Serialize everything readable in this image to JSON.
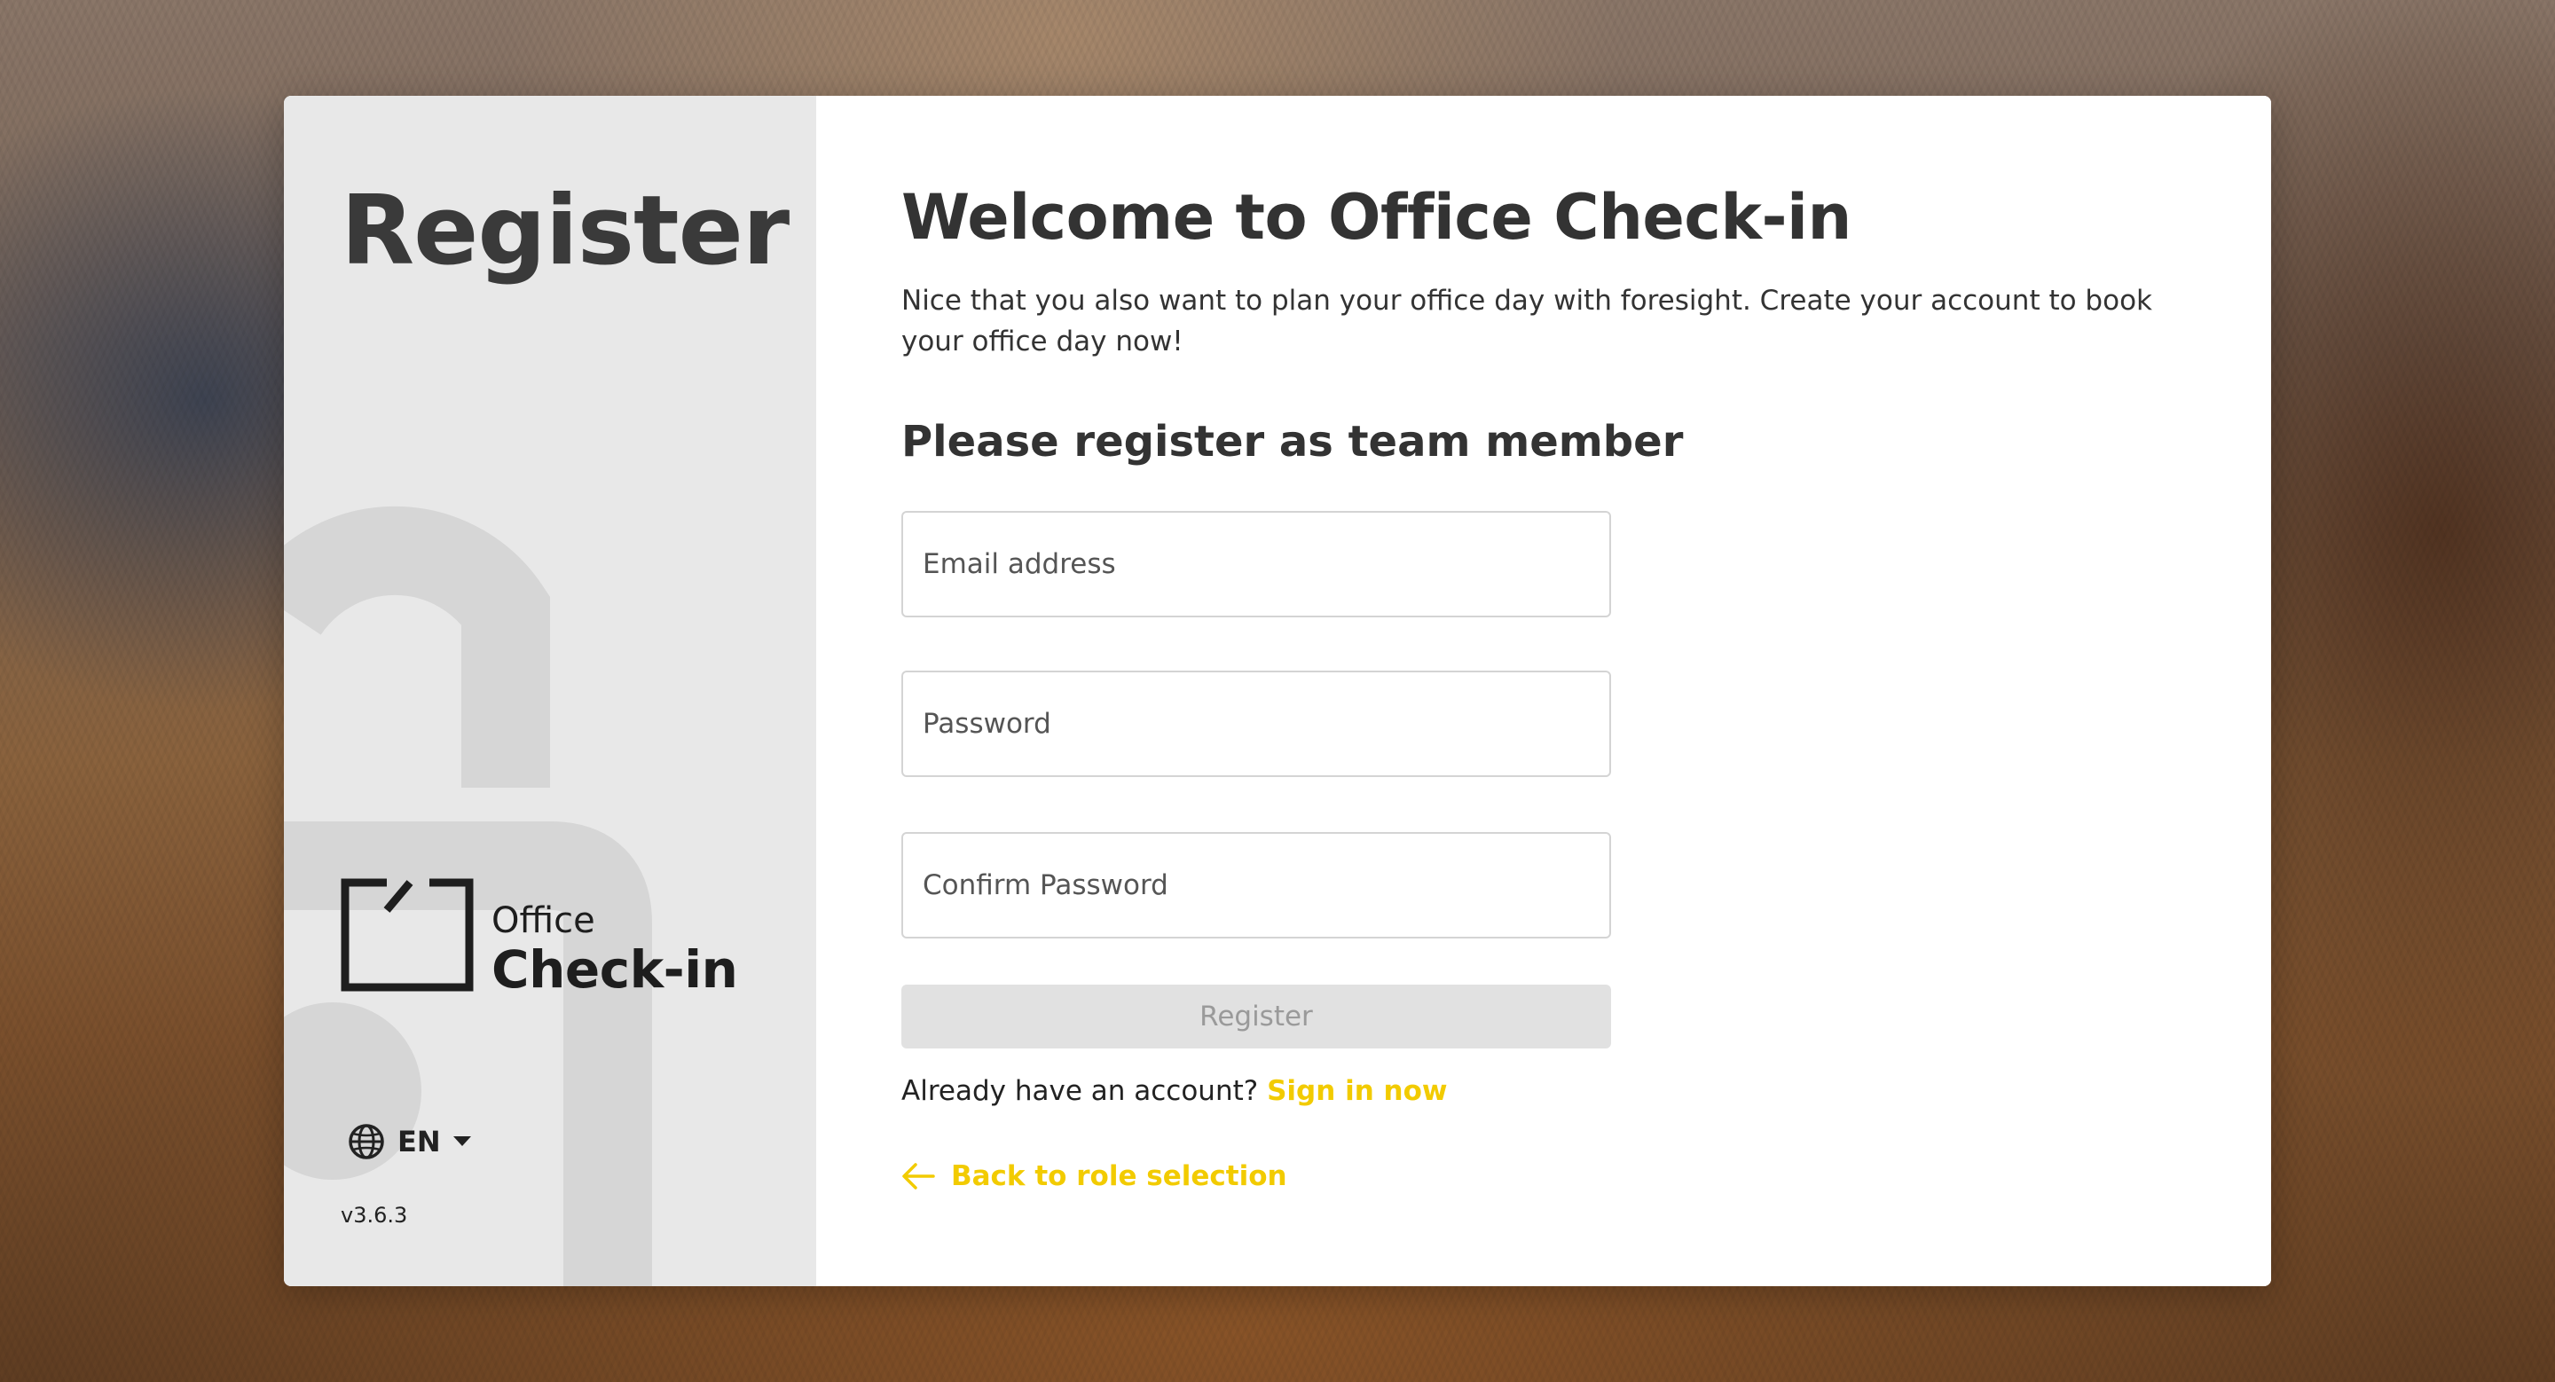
{
  "sidebar": {
    "title": "Register",
    "logo": {
      "line1": "Office",
      "line2": "Check-in"
    },
    "language": {
      "icon": "globe-icon",
      "code": "EN",
      "dropdown_icon": "caret-down-icon"
    },
    "version": "v3.6.3"
  },
  "main": {
    "heading": "Welcome to Office Check-in",
    "intro": "Nice that you also want to plan your office day with foresight. Create your account to book your office day now!",
    "subheading": "Please register as team member",
    "fields": {
      "email_placeholder": "Email address",
      "password_placeholder": "Password",
      "confirm_placeholder": "Confirm Password"
    },
    "register_button": "Register",
    "signin_prompt": "Already have an account?",
    "signin_link": "Sign in now",
    "back_link": "Back to role selection",
    "back_icon": "arrow-left-icon"
  },
  "colors": {
    "accent": "#f2cb00",
    "sidebar_bg": "#e8e8e8",
    "button_disabled_bg": "#e1e1e1",
    "text": "#333333"
  }
}
